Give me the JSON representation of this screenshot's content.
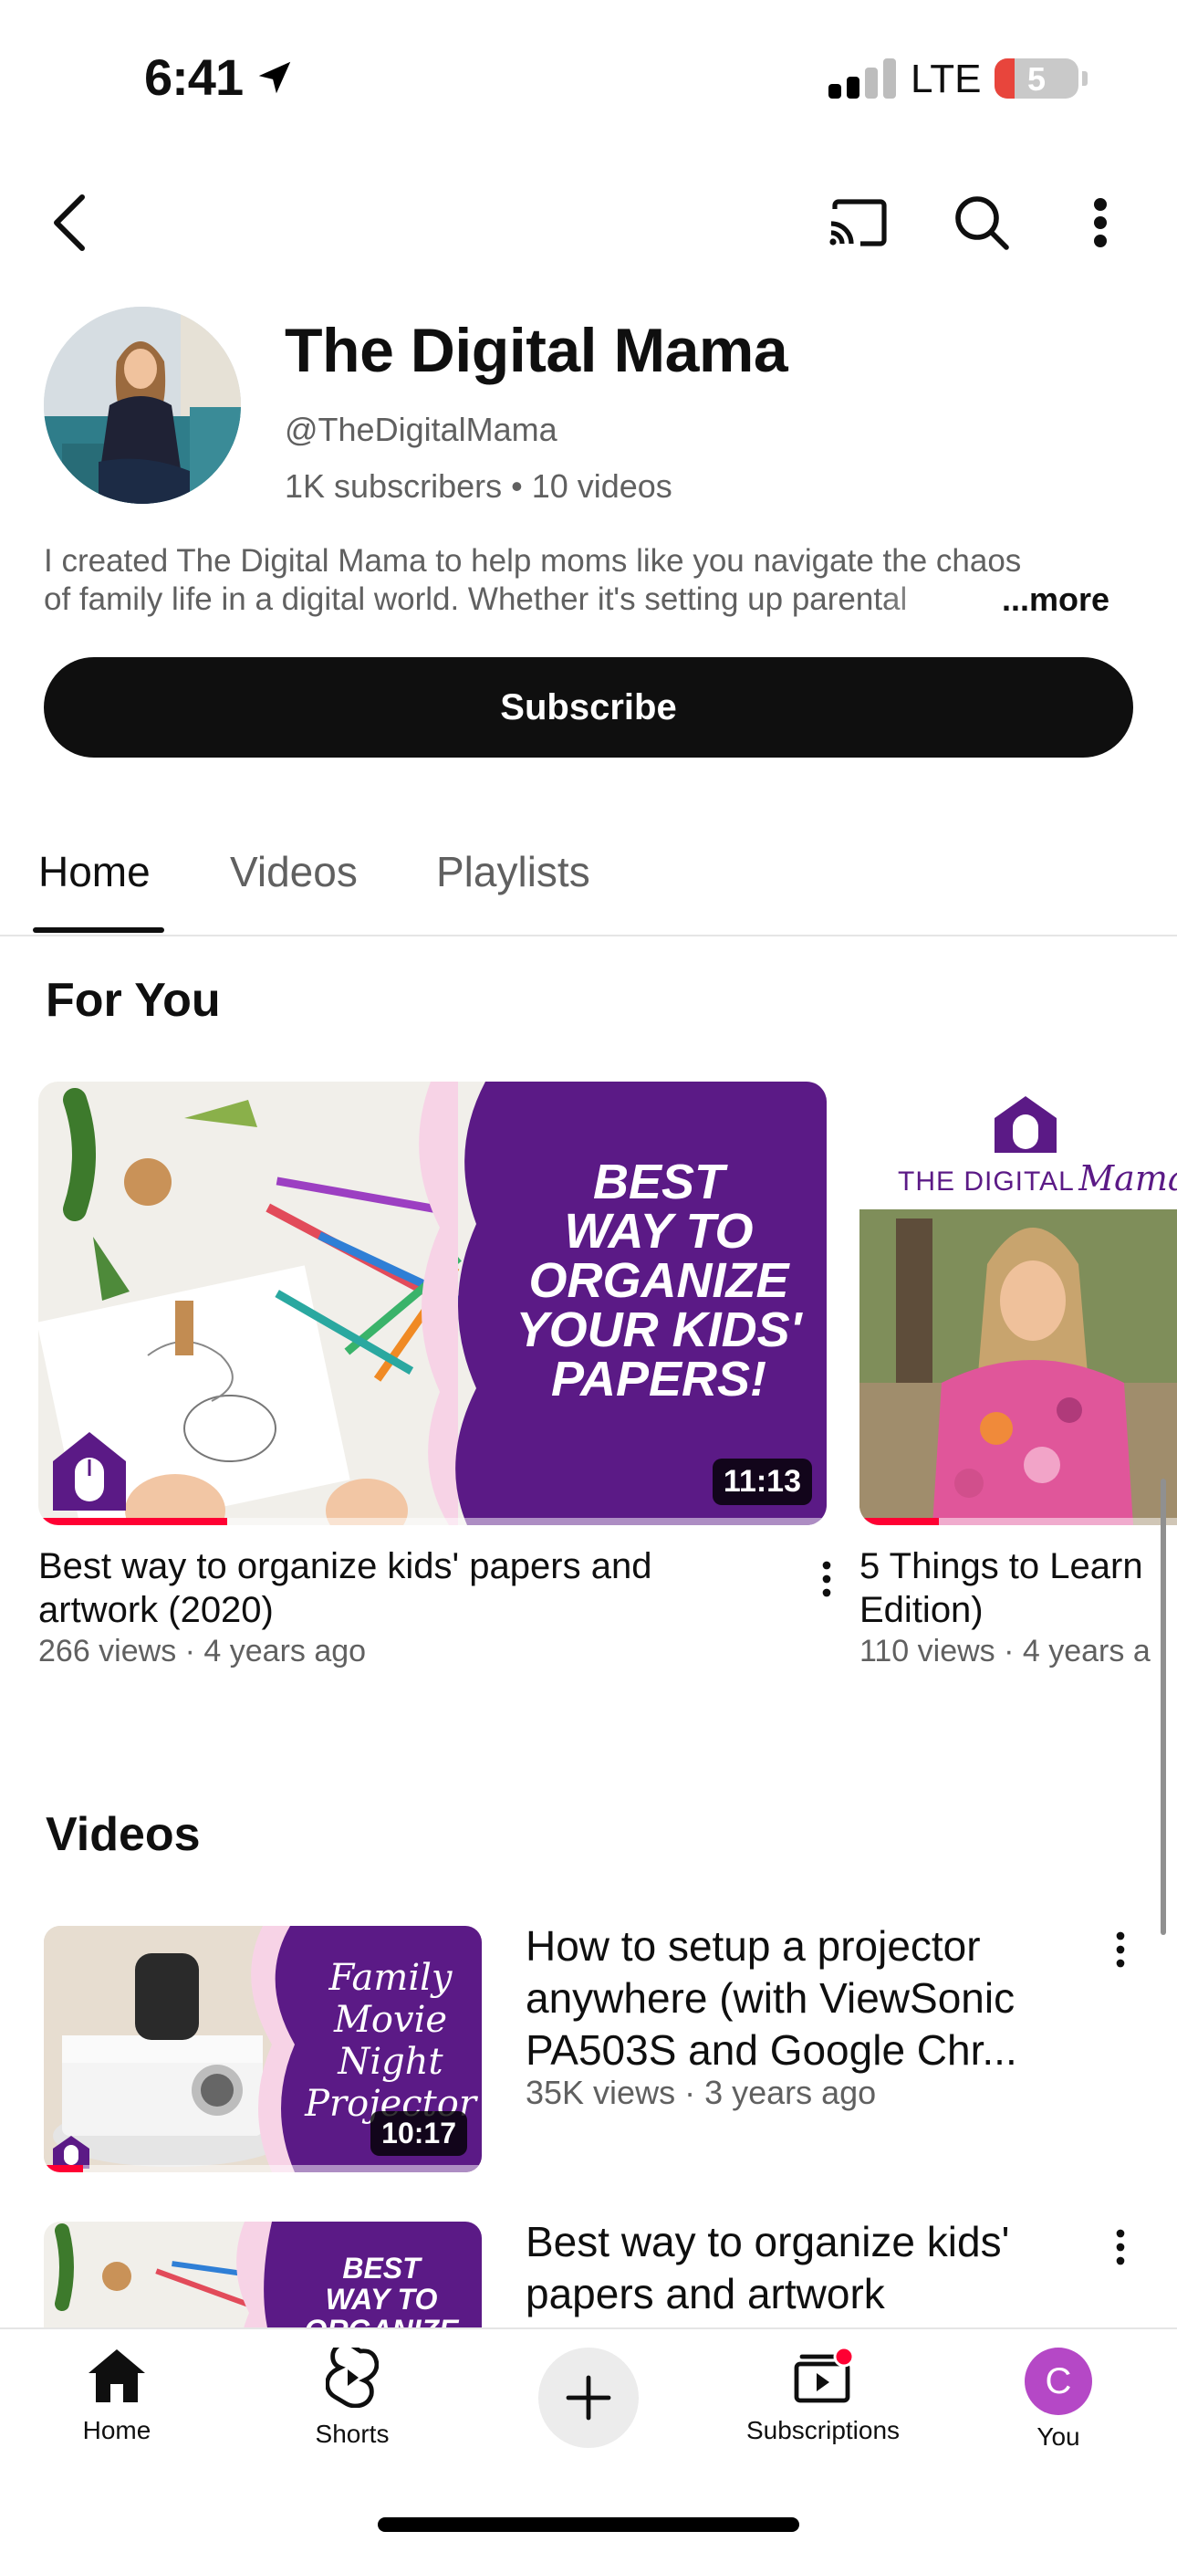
{
  "status_bar": {
    "time": "6:41",
    "network": "LTE",
    "battery": "5"
  },
  "header": {
    "back_icon": "chevron-left-icon",
    "cast_icon": "cast-icon",
    "search_icon": "search-icon",
    "more_icon": "more-vertical-icon"
  },
  "channel": {
    "name": "The Digital Mama",
    "handle": "@TheDigitalMama",
    "meta": "1K subscribers • 10 videos",
    "description_line1": "I created The Digital Mama to help moms like you navigate the chaos",
    "description_line2": "of family life in a digital world. Whether it's setting up parental",
    "more_label": "...more",
    "subscribe_label": "Subscribe"
  },
  "tabs": [
    {
      "label": "Home",
      "active": true
    },
    {
      "label": "Videos",
      "active": false
    },
    {
      "label": "Playlists",
      "active": false
    }
  ],
  "for_you": {
    "title": "For You",
    "cards": [
      {
        "thumb_text": "BEST WAY TO ORGANIZE YOUR KIDS' PAPERS!",
        "duration": "11:13",
        "progress": 0.24,
        "title": "Best way to organize kids' papers and artwork (2020)",
        "meta": "266 views · 4 years ago"
      },
      {
        "thumb_brand": "THE DIGITAL",
        "thumb_brand_script": "Mama",
        "progress": 0.25,
        "title": "5 Things to Learn",
        "title_line2": "Edition)",
        "meta": "110 views · 4 years a"
      }
    ]
  },
  "videos": {
    "title": "Videos",
    "items": [
      {
        "thumb_text": "Family Movie Night Projector",
        "duration": "10:17",
        "progress": 0.09,
        "title": "How to setup a projector anywhere (with ViewSonic PA503S and Google Chr...",
        "meta": "35K views · 3 years ago"
      },
      {
        "thumb_text": "BEST WAY TO ORGANIZE",
        "title": "Best way to organize kids' papers and artwork"
      }
    ]
  },
  "bottom_nav": {
    "home": "Home",
    "shorts": "Shorts",
    "subscriptions": "Subscriptions",
    "you": "You",
    "you_initial": "C"
  },
  "colors": {
    "brand_purple": "#5b1a86",
    "progress_red": "#ff0033",
    "avatar_purple": "#b548c6"
  }
}
